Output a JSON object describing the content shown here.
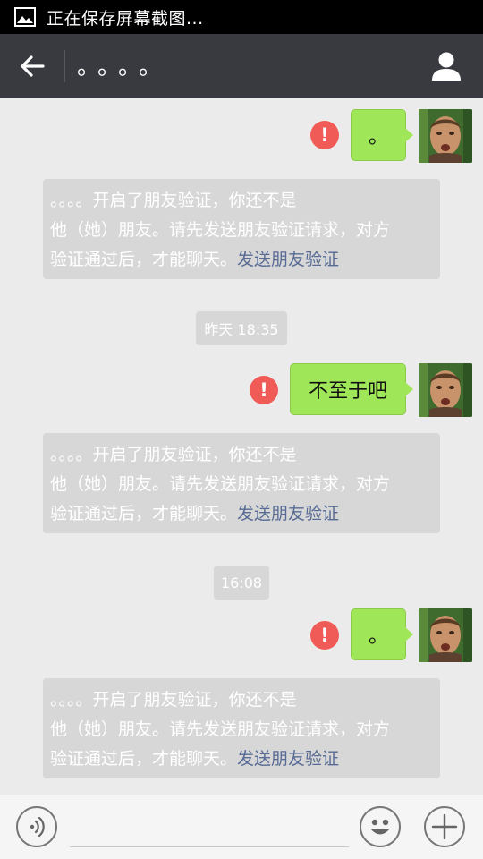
{
  "status_bar": {
    "text": "正在保存屏幕截图...",
    "icon": "image-icon"
  },
  "header": {
    "back_icon": "arrow-left-icon",
    "title": "。。。。",
    "profile_icon": "person-icon"
  },
  "messages": [
    {
      "type": "sent",
      "text": "。",
      "failed": true
    },
    {
      "type": "system",
      "line1": "。。。。开启了朋友验证，你还不是",
      "line2": "他（她）朋友。请先发送朋友验证请求，对方",
      "line3": "验证通过后，才能聊天。",
      "link": "发送朋友验证"
    },
    {
      "type": "time",
      "text": "昨天 18:35"
    },
    {
      "type": "sent",
      "text": "不至于吧",
      "failed": true
    },
    {
      "type": "system",
      "line1": "。。。。开启了朋友验证，你还不是",
      "line2": "他（她）朋友。请先发送朋友验证请求，对方",
      "line3": "验证通过后，才能聊天。",
      "link": "发送朋友验证"
    },
    {
      "type": "time",
      "text": "16:08"
    },
    {
      "type": "sent",
      "text": "。",
      "failed": true
    },
    {
      "type": "system",
      "line1": "。。。。开启了朋友验证，你还不是",
      "line2": "他（她）朋友。请先发送朋友验证请求，对方",
      "line3": "验证通过后，才能聊天。",
      "link": "发送朋友验证"
    }
  ],
  "error_mark": "!",
  "input_bar": {
    "voice_icon": "voice-icon",
    "emoji_icon": "emoji-icon",
    "plus_icon": "plus-icon",
    "input_value": ""
  },
  "colors": {
    "sent_bubble": "#9fe658",
    "error_badge": "#f05b57",
    "link": "#576b95",
    "header_bg": "#393a3f"
  }
}
